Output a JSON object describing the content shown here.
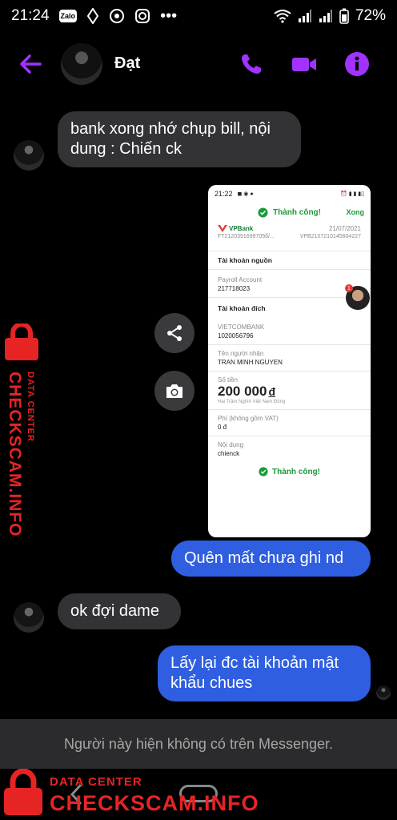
{
  "status_bar": {
    "time": "21:24",
    "zalo_label": "Zalo",
    "battery": "72%"
  },
  "header": {
    "contact_name": "Đạt"
  },
  "messages": [
    {
      "from": "them",
      "text": "bank xong nhớ chụp bill, nội dung : Chiến ck"
    },
    {
      "from": "me",
      "type": "image"
    },
    {
      "from": "me",
      "text": "Quên mất chưa ghi nd"
    },
    {
      "from": "them",
      "text": "ok đợi dame"
    },
    {
      "from": "me",
      "text": "Lấy lại đc tài khoản mật khẩu chues"
    }
  ],
  "receipt": {
    "status_time": "21:22",
    "success_title": "Thành công!",
    "done_label": "Xong",
    "bank_brand": "VPBank",
    "date": "21/07/2021",
    "ref_left": "FT2120391699705б/...",
    "ref_right": "VPB2107210145604227",
    "source_section": "Tài khoản nguồn",
    "source_account_type": "Payroll Account",
    "source_account_number": "217718023",
    "dest_section": "Tài khoản đích",
    "dest_bank": "VIETCOMBANK",
    "dest_account_number": "1020056796",
    "recipient_label": "Tên người nhận",
    "recipient_name": "TRAN MINH NGUYEN",
    "amount_label": "Số tiền",
    "amount": "200 000",
    "currency": "đ",
    "amount_words": "Hai Trăm Nghìn Việt Nam Đồng",
    "fee_label": "Phí (không gồm VAT)",
    "fee": "0 đ",
    "content_label": "Nội dung",
    "content": "chienck",
    "footer_success": "Thành công!",
    "badge_count": "1"
  },
  "notice": "Người này hiện không có trên Messenger.",
  "watermark": {
    "data_center": "DATA CENTER",
    "checkscam": "CHECKSCAM.INFO"
  },
  "colors": {
    "accent": "#a033ff",
    "outgoing": "#2f5fe0",
    "incoming": "#333335",
    "watermark": "#e62424",
    "success": "#1a9a3a"
  }
}
